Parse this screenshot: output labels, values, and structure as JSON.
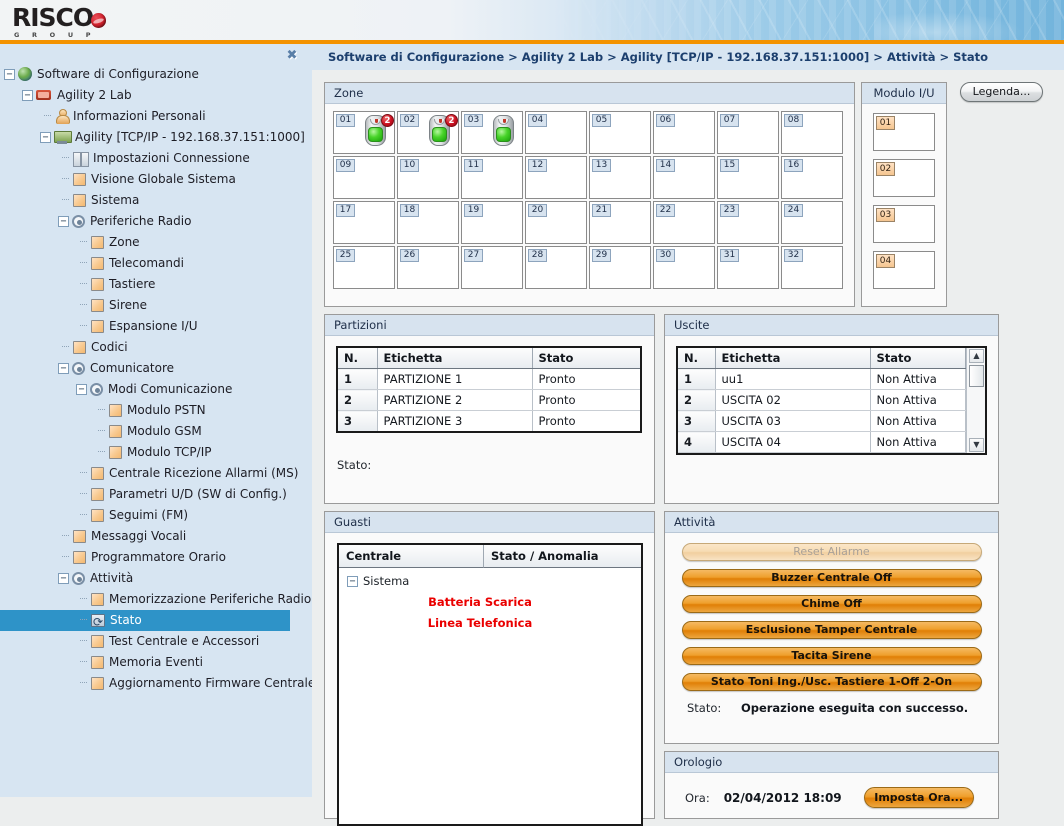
{
  "brand": {
    "name": "RISCO",
    "subtitle": "G R O U P",
    "accent": "#f39200"
  },
  "sidebar": {
    "close_label": "✖",
    "tree": [
      {
        "label": "Software di Configurazione",
        "depth": 0,
        "icon": "globe-icon",
        "expander": "−"
      },
      {
        "label": "Agility 2 Lab",
        "depth": 1,
        "icon": "network-icon",
        "expander": "−"
      },
      {
        "label": "Informazioni Personali",
        "depth": 2,
        "icon": "person-icon",
        "expander": ""
      },
      {
        "label": "Agility [TCP/IP - 192.168.37.151:1000]",
        "depth": 2,
        "icon": "device-icon",
        "expander": "−"
      },
      {
        "label": "Impostazioni Connessione",
        "depth": 3,
        "icon": "connection-icon",
        "expander": ""
      },
      {
        "label": "Visione Globale Sistema",
        "depth": 3,
        "icon": "folder-icon",
        "expander": ""
      },
      {
        "label": "Sistema",
        "depth": 3,
        "icon": "folder-icon",
        "expander": ""
      },
      {
        "label": "Periferiche Radio",
        "depth": 3,
        "icon": "radio-icon",
        "expander": "−"
      },
      {
        "label": "Zone",
        "depth": 4,
        "icon": "folder-icon",
        "expander": ""
      },
      {
        "label": "Telecomandi",
        "depth": 4,
        "icon": "folder-icon",
        "expander": ""
      },
      {
        "label": "Tastiere",
        "depth": 4,
        "icon": "folder-icon",
        "expander": ""
      },
      {
        "label": "Sirene",
        "depth": 4,
        "icon": "folder-icon",
        "expander": ""
      },
      {
        "label": "Espansione I/U",
        "depth": 4,
        "icon": "folder-icon",
        "expander": ""
      },
      {
        "label": "Codici",
        "depth": 3,
        "icon": "folder-icon",
        "expander": ""
      },
      {
        "label": "Comunicatore",
        "depth": 3,
        "icon": "radio-icon",
        "expander": "−"
      },
      {
        "label": "Modi Comunicazione",
        "depth": 4,
        "icon": "radio-icon",
        "expander": "−"
      },
      {
        "label": "Modulo PSTN",
        "depth": 5,
        "icon": "folder-icon",
        "expander": ""
      },
      {
        "label": "Modulo GSM",
        "depth": 5,
        "icon": "folder-icon",
        "expander": ""
      },
      {
        "label": "Modulo TCP/IP",
        "depth": 5,
        "icon": "folder-icon",
        "expander": ""
      },
      {
        "label": "Centrale Ricezione Allarmi (MS)",
        "depth": 4,
        "icon": "folder-icon",
        "expander": ""
      },
      {
        "label": "Parametri U/D (SW di Config.)",
        "depth": 4,
        "icon": "folder-icon",
        "expander": ""
      },
      {
        "label": "Seguimi (FM)",
        "depth": 4,
        "icon": "folder-icon",
        "expander": ""
      },
      {
        "label": "Messaggi Vocali",
        "depth": 3,
        "icon": "folder-icon",
        "expander": ""
      },
      {
        "label": "Programmatore Orario",
        "depth": 3,
        "icon": "folder-icon",
        "expander": ""
      },
      {
        "label": "Attività",
        "depth": 3,
        "icon": "radio-icon",
        "expander": "−"
      },
      {
        "label": "Memorizzazione Periferiche Radio",
        "depth": 4,
        "icon": "folder-icon",
        "expander": ""
      },
      {
        "label": "Stato",
        "depth": 4,
        "icon": "status-icon",
        "expander": "",
        "selected": true
      },
      {
        "label": "Test Centrale e Accessori",
        "depth": 4,
        "icon": "folder-icon",
        "expander": ""
      },
      {
        "label": "Memoria Eventi",
        "depth": 4,
        "icon": "folder-icon",
        "expander": ""
      },
      {
        "label": "Aggiornamento Firmware Centrale",
        "depth": 4,
        "icon": "folder-icon",
        "expander": ""
      }
    ]
  },
  "breadcrumb": "Software di Configurazione > Agility 2 Lab > Agility [TCP/IP - 192.168.37.151:1000] > Attività > Stato",
  "zone_panel": {
    "title": "Zone",
    "cells": [
      {
        "n": "01",
        "detector": true,
        "badge": "2"
      },
      {
        "n": "02",
        "detector": true,
        "badge": "2"
      },
      {
        "n": "03",
        "detector": true,
        "badge": ""
      },
      {
        "n": "04",
        "detector": false,
        "badge": ""
      },
      {
        "n": "05",
        "detector": false,
        "badge": ""
      },
      {
        "n": "06",
        "detector": false,
        "badge": ""
      },
      {
        "n": "07",
        "detector": false,
        "badge": ""
      },
      {
        "n": "08",
        "detector": false,
        "badge": ""
      },
      {
        "n": "09",
        "detector": false,
        "badge": ""
      },
      {
        "n": "10",
        "detector": false,
        "badge": ""
      },
      {
        "n": "11",
        "detector": false,
        "badge": ""
      },
      {
        "n": "12",
        "detector": false,
        "badge": ""
      },
      {
        "n": "13",
        "detector": false,
        "badge": ""
      },
      {
        "n": "14",
        "detector": false,
        "badge": ""
      },
      {
        "n": "15",
        "detector": false,
        "badge": ""
      },
      {
        "n": "16",
        "detector": false,
        "badge": ""
      },
      {
        "n": "17",
        "detector": false,
        "badge": ""
      },
      {
        "n": "18",
        "detector": false,
        "badge": ""
      },
      {
        "n": "19",
        "detector": false,
        "badge": ""
      },
      {
        "n": "20",
        "detector": false,
        "badge": ""
      },
      {
        "n": "21",
        "detector": false,
        "badge": ""
      },
      {
        "n": "22",
        "detector": false,
        "badge": ""
      },
      {
        "n": "23",
        "detector": false,
        "badge": ""
      },
      {
        "n": "24",
        "detector": false,
        "badge": ""
      },
      {
        "n": "25",
        "detector": false,
        "badge": ""
      },
      {
        "n": "26",
        "detector": false,
        "badge": ""
      },
      {
        "n": "27",
        "detector": false,
        "badge": ""
      },
      {
        "n": "28",
        "detector": false,
        "badge": ""
      },
      {
        "n": "29",
        "detector": false,
        "badge": ""
      },
      {
        "n": "30",
        "detector": false,
        "badge": ""
      },
      {
        "n": "31",
        "detector": false,
        "badge": ""
      },
      {
        "n": "32",
        "detector": false,
        "badge": ""
      }
    ]
  },
  "io_panel": {
    "title": "Modulo I/U",
    "cells": [
      "01",
      "02",
      "03",
      "04"
    ]
  },
  "legenda_button": "Legenda...",
  "partitions": {
    "title": "Partizioni",
    "headers": [
      "N.",
      "Etichetta",
      "Stato"
    ],
    "rows": [
      [
        "1",
        "PARTIZIONE 1",
        "Pronto"
      ],
      [
        "2",
        "PARTIZIONE 2",
        "Pronto"
      ],
      [
        "3",
        "PARTIZIONE 3",
        "Pronto"
      ]
    ],
    "status_label": "Stato:",
    "status_value": ""
  },
  "outputs": {
    "title": "Uscite",
    "headers": [
      "N.",
      "Etichetta",
      "Stato"
    ],
    "rows": [
      [
        "1",
        "uu1",
        "Non Attiva"
      ],
      [
        "2",
        "USCITA 02",
        "Non Attiva"
      ],
      [
        "3",
        "USCITA 03",
        "Non Attiva"
      ],
      [
        "4",
        "USCITA 04",
        "Non Attiva"
      ]
    ],
    "scroll_up": "▲",
    "scroll_down": "▼"
  },
  "faults": {
    "title": "Guasti",
    "headers": [
      "Centrale",
      "Stato / Anomalia"
    ],
    "group": "Sistema",
    "group_expander": "−",
    "items": [
      "Batteria Scarica",
      "Linea Telefonica"
    ],
    "color": "#ea0000"
  },
  "activity": {
    "title": "Attività",
    "buttons": [
      {
        "label": "Reset Allarme",
        "disabled": true
      },
      {
        "label": "Buzzer Centrale Off",
        "disabled": false
      },
      {
        "label": "Chime Off",
        "disabled": false
      },
      {
        "label": "Esclusione Tamper Centrale",
        "disabled": false
      },
      {
        "label": "Tacita Sirene",
        "disabled": false
      },
      {
        "label": "Stato Toni Ing./Usc. Tastiere  1-Off  2-On",
        "disabled": false
      }
    ],
    "status_label": "Stato:",
    "status_value": "Operazione eseguita con successo."
  },
  "clock": {
    "title": "Orologio",
    "label": "Ora:",
    "value": "02/04/2012 18:09",
    "button": "Imposta Ora..."
  }
}
